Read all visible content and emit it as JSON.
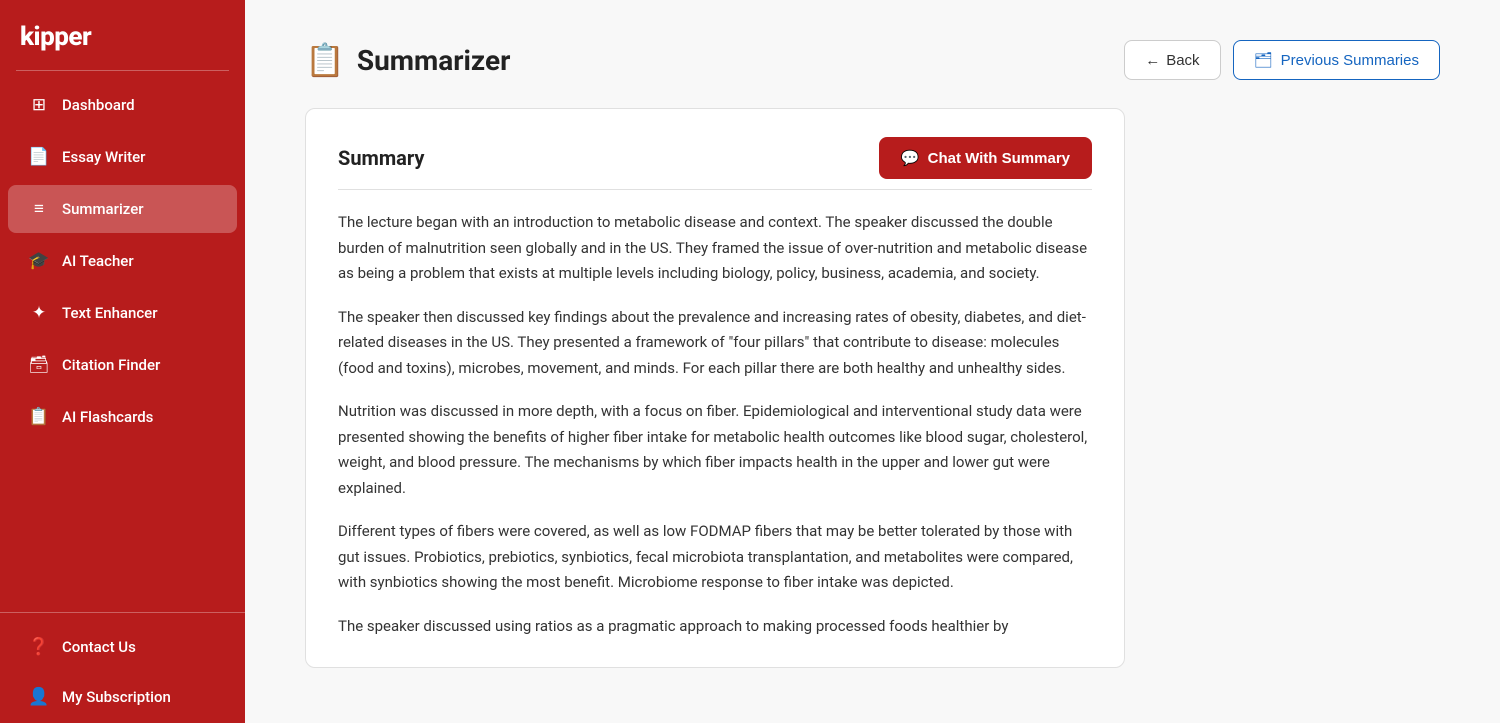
{
  "app": {
    "logo": "kipper"
  },
  "sidebar": {
    "items": [
      {
        "id": "dashboard",
        "label": "Dashboard",
        "icon": "⊞",
        "active": false
      },
      {
        "id": "essay-writer",
        "label": "Essay Writer",
        "icon": "📄",
        "active": false
      },
      {
        "id": "summarizer",
        "label": "Summarizer",
        "icon": "≡",
        "active": true
      },
      {
        "id": "ai-teacher",
        "label": "AI Teacher",
        "icon": "🎓",
        "active": false
      },
      {
        "id": "text-enhancer",
        "label": "Text Enhancer",
        "icon": "✦",
        "active": false
      },
      {
        "id": "citation-finder",
        "label": "Citation Finder",
        "icon": "🗃",
        "active": false
      },
      {
        "id": "ai-flashcards",
        "label": "AI Flashcards",
        "icon": "📋",
        "active": false
      }
    ],
    "bottom_items": [
      {
        "id": "contact-us",
        "label": "Contact Us",
        "icon": "❓"
      },
      {
        "id": "my-subscription",
        "label": "My Subscription",
        "icon": "👤"
      }
    ]
  },
  "header": {
    "page_icon": "📋",
    "page_title": "Summarizer",
    "back_label": "Back",
    "back_icon": "←",
    "prev_summaries_label": "Previous Summaries",
    "prev_summaries_icon": "🗂"
  },
  "summary": {
    "title": "Summary",
    "chat_button_label": "Chat With Summary",
    "chat_button_icon": "💬",
    "paragraphs": [
      "The lecture began with an introduction to metabolic disease and context. The speaker discussed the double burden of malnutrition seen globally and in the US. They framed the issue of over-nutrition and metabolic disease as being a problem that exists at multiple levels including biology, policy, business, academia, and society.",
      "The speaker then discussed key findings about the prevalence and increasing rates of obesity, diabetes, and diet-related diseases in the US. They presented a framework of \"four pillars\" that contribute to disease: molecules (food and toxins), microbes, movement, and minds. For each pillar there are both healthy and unhealthy sides.",
      "Nutrition was discussed in more depth, with a focus on fiber. Epidemiological and interventional study data were presented showing the benefits of higher fiber intake for metabolic health outcomes like blood sugar, cholesterol, weight, and blood pressure. The mechanisms by which fiber impacts health in the upper and lower gut were explained.",
      "Different types of fibers were covered, as well as low FODMAP fibers that may be better tolerated by those with gut issues. Probiotics, prebiotics, synbiotics, fecal microbiota transplantation, and metabolites were compared, with synbiotics showing the most benefit. Microbiome response to fiber intake was depicted.",
      "The speaker discussed using ratios as a pragmatic approach to making processed foods healthier by"
    ]
  }
}
